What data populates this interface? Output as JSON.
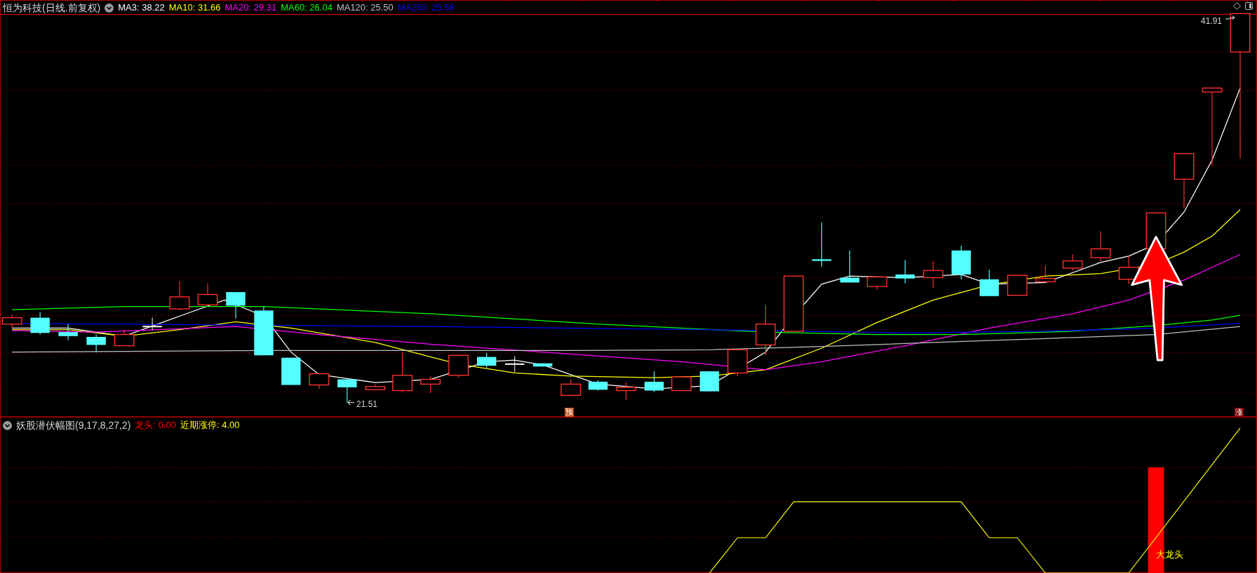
{
  "main_pane": {
    "title": "恒为科技(日线.前复权)",
    "moving_averages": [
      {
        "label": "MA3: 38.22",
        "color": "#ffffff"
      },
      {
        "label": "MA10: 31.66",
        "color": "#ffff00"
      },
      {
        "label": "MA20: 29.31",
        "color": "#ff00ff"
      },
      {
        "label": "MA60: 26.04",
        "color": "#00ff00"
      },
      {
        "label": "MA120: 25.50",
        "color": "#c0c0c0"
      },
      {
        "label": "MA250: 25.58",
        "color": "#0000ff"
      }
    ],
    "high_label": "41.91",
    "low_label": "21.51",
    "badges": [
      {
        "text": "预",
        "color": "#c0501a"
      },
      {
        "text": "涨",
        "color": "#800000"
      }
    ]
  },
  "indicator_pane": {
    "title": "妖股潜伏幅图(9,17,8,27,2)",
    "values": [
      {
        "label": "龙头: 0.00",
        "color": "#ff0000"
      },
      {
        "label": "近期涨停: 4.00",
        "color": "#ffff00"
      }
    ],
    "bar_label": "大龙头"
  }
}
